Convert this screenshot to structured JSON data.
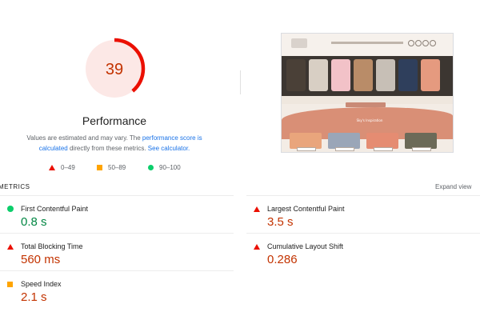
{
  "performance": {
    "score": "39",
    "score_fraction": 0.39,
    "title": "Performance",
    "desc_before": "Values are estimated and may vary. The ",
    "desc_link1": "performance score is calculated",
    "desc_middle": " directly from these metrics. ",
    "desc_link2": "See calculator.",
    "colors": {
      "fail": "#eb0f00",
      "fail_text": "#c33300",
      "fail_bg": "#fce8e6",
      "average": "#ffa400",
      "pass": "#0cce6b",
      "pass_text": "#018642"
    }
  },
  "legend": [
    {
      "icon": "triangle-icon",
      "label": "0–49"
    },
    {
      "icon": "square-icon",
      "label": "50–89"
    },
    {
      "icon": "circle-icon",
      "label": "90–100"
    }
  ],
  "metrics_header": {
    "label": "METRICS",
    "expand": "Expand view"
  },
  "metrics": {
    "fcp": {
      "name": "First Contentful Paint",
      "value": "0.8 s",
      "rating": "pass"
    },
    "lcp": {
      "name": "Largest Contentful Paint",
      "value": "3.5 s",
      "rating": "fail"
    },
    "tbt": {
      "name": "Total Blocking Time",
      "value": "560 ms",
      "rating": "fail"
    },
    "cls": {
      "name": "Cumulative Layout Shift",
      "value": "0.286",
      "rating": "fail"
    },
    "si": {
      "name": "Speed Index",
      "value": "2.1 s",
      "rating": "average"
    }
  },
  "thumbnail": {
    "banner_text": "Sky's Inspiration"
  }
}
